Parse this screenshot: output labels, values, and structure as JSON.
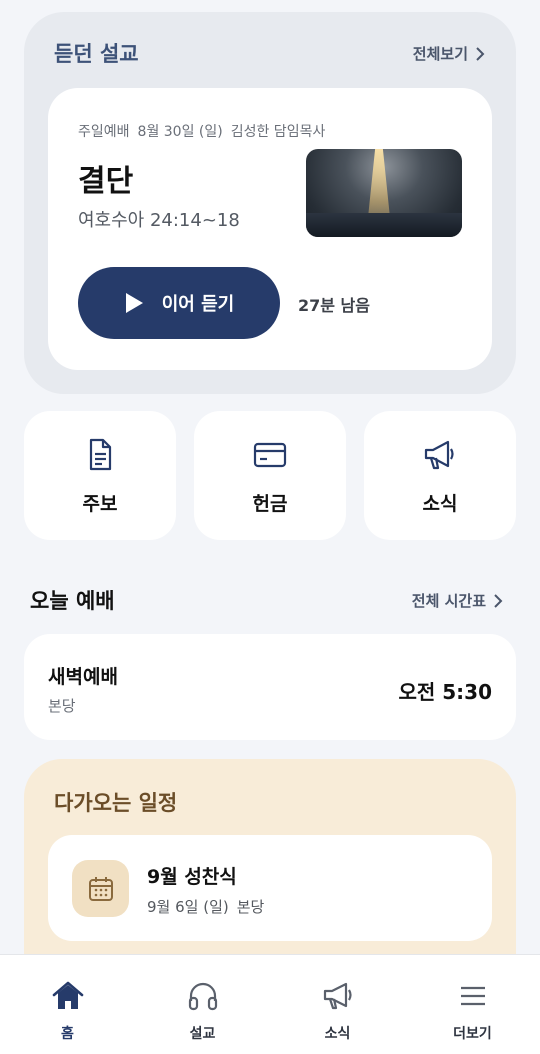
{
  "heard_sermon": {
    "section_title": "듣던 설교",
    "see_all_label": "전체보기",
    "service_type": "주일예배",
    "date": "8월 30일 (일)",
    "preacher": "김성한 담임목사",
    "title": "결단",
    "passage": "여호수아 24:14~18",
    "resume_label": "이어 듣기",
    "remaining": "27분 남음"
  },
  "quick_menu": [
    {
      "label": "주보",
      "icon": "document-icon"
    },
    {
      "label": "헌금",
      "icon": "card-icon"
    },
    {
      "label": "소식",
      "icon": "megaphone-icon"
    }
  ],
  "today_worship": {
    "section_title": "오늘 예배",
    "schedule_link_label": "전체 시간표",
    "service_name": "새벽예배",
    "location": "본당",
    "time": "오전 5:30"
  },
  "upcoming": {
    "section_title": "다가오는 일정",
    "event_title": "9월 성찬식",
    "event_date": "9월 6일 (일)",
    "event_location": "본당"
  },
  "tab_bar": [
    {
      "label": "홈",
      "icon": "home-icon",
      "active": true
    },
    {
      "label": "설교",
      "icon": "headphones-icon",
      "active": false
    },
    {
      "label": "소식",
      "icon": "megaphone-icon",
      "active": false
    },
    {
      "label": "더보기",
      "icon": "menu-icon",
      "active": false
    }
  ],
  "colors": {
    "accent_navy": "#263b6a",
    "panel_gray": "#e7eaef",
    "panel_beige": "#f8ecd8",
    "beige_text": "#6b4d28"
  }
}
